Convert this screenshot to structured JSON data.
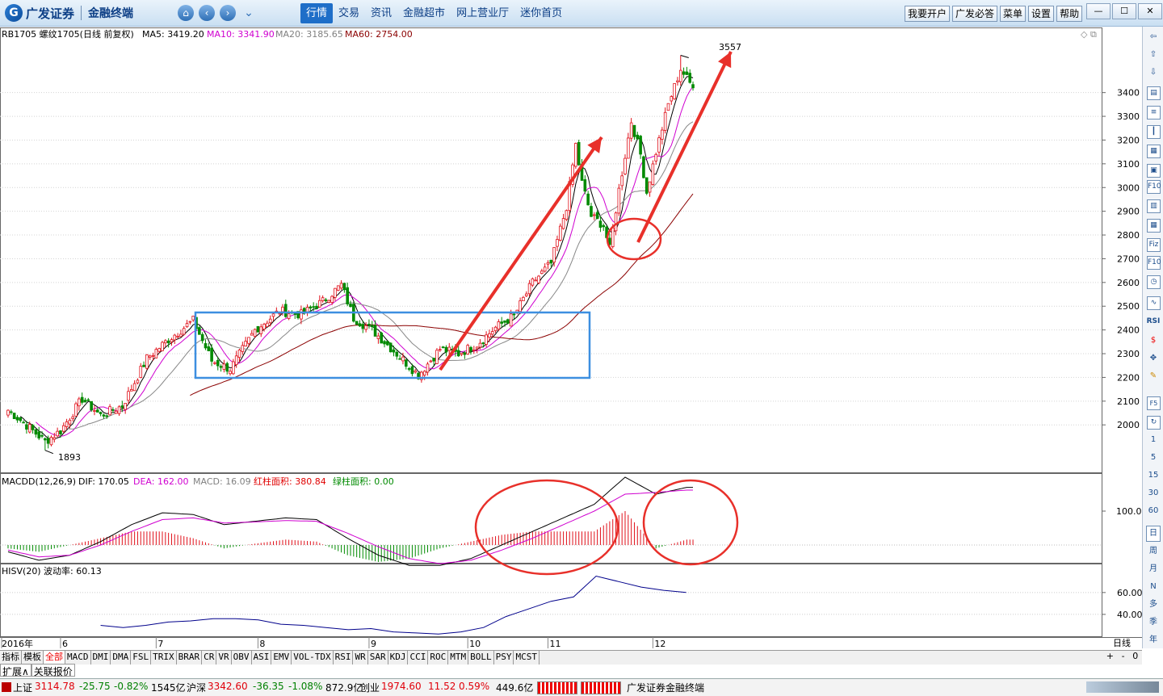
{
  "app": {
    "brand": "广发证券",
    "subtitle": "金融终端",
    "menu": [
      "行情",
      "交易",
      "资讯",
      "金融超市",
      "网上营业厅",
      "迷你首页"
    ],
    "right_buttons": [
      "我要开户",
      "广发必答",
      "菜单",
      "设置",
      "帮助"
    ]
  },
  "legends": {
    "main": {
      "symbol": "RB1705 螺纹1705(日线 前复权)",
      "ma5": "MA5: 3419.20",
      "ma10": "MA10: 3341.90",
      "ma20": "MA20: 3185.65",
      "ma60": "MA60: 2754.00"
    },
    "macd": {
      "name": "MACDD(12,26,9)",
      "dif": "DIF: 170.05",
      "dea": "DEA: 162.00",
      "macd": "MACD: 16.09",
      "red_area": "红柱面积: 380.84",
      "green_area": "绿柱面积: 0.00"
    },
    "hisv": {
      "name": "HISV(20)",
      "value": "波动率: 60.13"
    }
  },
  "annotations": {
    "high": "3557",
    "low": "1893"
  },
  "axis": {
    "price_ticks": [
      "3400",
      "3300",
      "3200",
      "3100",
      "3000",
      "2900",
      "2800",
      "2700",
      "2600",
      "2500",
      "2400",
      "2300",
      "2200",
      "2100",
      "2000"
    ],
    "macd_tick": "100.0",
    "hisv_ticks": [
      "60.00",
      "40.00"
    ],
    "x_labels": [
      {
        "label": "2016年",
        "i": 0
      },
      {
        "label": "6",
        "i": 17
      },
      {
        "label": "7",
        "i": 48
      },
      {
        "label": "8",
        "i": 81
      },
      {
        "label": "9",
        "i": 117
      },
      {
        "label": "10",
        "i": 149
      },
      {
        "label": "11",
        "i": 175
      },
      {
        "label": "12",
        "i": 209
      }
    ],
    "period_label": "日线"
  },
  "chart_data": [
    {
      "type": "candlestick",
      "title": "RB1705 螺纹1705(日线 前复权)",
      "ylim": [
        1800,
        3620
      ],
      "indicators": [
        "MA5",
        "MA10",
        "MA20",
        "MA60"
      ],
      "anchors": [
        {
          "i": 0,
          "close": 2062
        },
        {
          "i": 5,
          "close": 2010
        },
        {
          "i": 12,
          "close": 1930
        },
        {
          "i": 17,
          "close": 1975
        },
        {
          "i": 24,
          "close": 2110
        },
        {
          "i": 30,
          "close": 2040
        },
        {
          "i": 37,
          "close": 2080
        },
        {
          "i": 45,
          "close": 2280
        },
        {
          "i": 52,
          "close": 2360
        },
        {
          "i": 60,
          "close": 2440
        },
        {
          "i": 66,
          "close": 2270
        },
        {
          "i": 72,
          "close": 2235
        },
        {
          "i": 80,
          "close": 2400
        },
        {
          "i": 88,
          "close": 2480
        },
        {
          "i": 95,
          "close": 2465
        },
        {
          "i": 102,
          "close": 2520
        },
        {
          "i": 108,
          "close": 2590
        },
        {
          "i": 112,
          "close": 2450
        },
        {
          "i": 118,
          "close": 2400
        },
        {
          "i": 126,
          "close": 2300
        },
        {
          "i": 133,
          "close": 2210
        },
        {
          "i": 140,
          "close": 2320
        },
        {
          "i": 146,
          "close": 2300
        },
        {
          "i": 152,
          "close": 2340
        },
        {
          "i": 158,
          "close": 2410
        },
        {
          "i": 164,
          "close": 2460
        },
        {
          "i": 170,
          "close": 2600
        },
        {
          "i": 176,
          "close": 2680
        },
        {
          "i": 181,
          "close": 2920
        },
        {
          "i": 184,
          "close": 3180
        },
        {
          "i": 186,
          "close": 3020
        },
        {
          "i": 189,
          "close": 2880
        },
        {
          "i": 193,
          "close": 2840
        },
        {
          "i": 195,
          "close": 2740
        },
        {
          "i": 198,
          "close": 2990
        },
        {
          "i": 202,
          "close": 3280
        },
        {
          "i": 205,
          "close": 3140
        },
        {
          "i": 207,
          "close": 2980
        },
        {
          "i": 210,
          "close": 3150
        },
        {
          "i": 214,
          "close": 3350
        },
        {
          "i": 218,
          "close": 3500
        },
        {
          "i": 222,
          "close": 3420
        }
      ],
      "high": 3557,
      "low": 1893
    },
    {
      "type": "line",
      "title": "MACDD(12,26,9)",
      "series": [
        {
          "name": "DIF",
          "values": [
            -20,
            -45,
            -30,
            10,
            60,
            95,
            90,
            60,
            70,
            80,
            75,
            20,
            -30,
            -60,
            -60,
            -40,
            0,
            40,
            80,
            120,
            200,
            150,
            170
          ]
        },
        {
          "name": "DEA",
          "values": [
            -15,
            -35,
            -30,
            0,
            40,
            75,
            80,
            65,
            68,
            72,
            70,
            35,
            -5,
            -40,
            -55,
            -45,
            -15,
            20,
            60,
            100,
            150,
            155,
            162
          ]
        }
      ],
      "x_index_step": 10
    },
    {
      "type": "line",
      "title": "HISV(20)",
      "ylim": [
        20,
        85
      ],
      "series": [
        {
          "name": "HISV",
          "values": [
            30,
            28,
            30,
            33,
            34,
            36,
            36,
            35,
            31,
            30,
            28,
            26,
            27,
            24,
            23,
            22,
            24,
            28,
            38,
            45,
            52,
            56,
            75,
            70,
            65,
            62,
            60
          ]
        }
      ],
      "x_index_start": 30,
      "x_index_step": 7.3
    }
  ],
  "toolbar_right": [
    "1",
    "5",
    "15",
    "30",
    "60",
    "日",
    "周",
    "月",
    "N",
    "多",
    "季",
    "年"
  ],
  "tabs": [
    "指标",
    "模板",
    "全部",
    "MACD",
    "DMI",
    "DMA",
    "FSL",
    "TRIX",
    "BRAR",
    "CR",
    "VR",
    "OBV",
    "ASI",
    "EMV",
    "VOL-TDX",
    "RSI",
    "WR",
    "SAR",
    "KDJ",
    "CCI",
    "ROC",
    "MTM",
    "BOLL",
    "PSY",
    "MCST"
  ],
  "subtabs": [
    "扩展∧",
    "关联报价"
  ],
  "status": {
    "sh_name": "上证",
    "sh_val": "3114.78",
    "sh_chg": "-25.75",
    "sh_pct": "-0.82%",
    "sh_amt": "1545亿",
    "hs_name": "沪深",
    "hs_val": "3342.60",
    "hs_chg": "-36.35",
    "hs_pct": "-1.08%",
    "hs_amt": "872.9亿",
    "cy_name": "创业",
    "cy_val": "1974.60",
    "cy_chg": "11.52",
    "cy_pct": "0.59%",
    "cy_amt": "449.6亿",
    "footer": "广发证券金融终端"
  },
  "colors": {
    "up": "#e0101a",
    "down": "#008a00",
    "ma5": "#000000",
    "ma10": "#d000d0",
    "ma20": "#888888",
    "ma60": "#8b0000",
    "annot_red": "#e8302a",
    "annot_blue": "#3d8fe0"
  }
}
